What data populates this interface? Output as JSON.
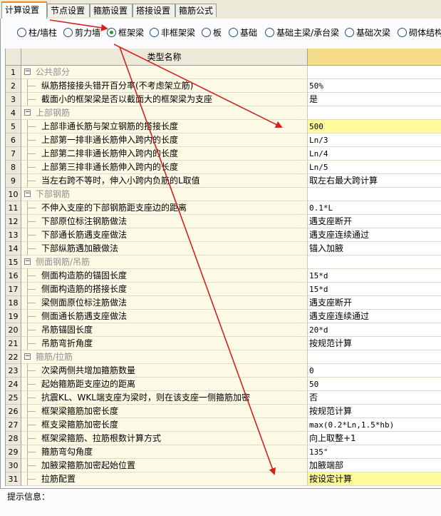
{
  "tabs": [
    "计算设置",
    "节点设置",
    "箍筋设置",
    "搭接设置",
    "箍筋公式"
  ],
  "radios": [
    "柱/墙柱",
    "剪力墙",
    "框架梁",
    "非框架梁",
    "板",
    "基础",
    "基础主梁/承台梁",
    "基础次梁",
    "砌体结构"
  ],
  "selected_radio": "框架梁",
  "grid": {
    "header": "类型名称",
    "rows": [
      {
        "n": "1",
        "name": "公共部分",
        "value": "",
        "group": true
      },
      {
        "n": "2",
        "name": "纵筋搭接接头错开百分率(不考虑架立筋)",
        "value": "50%"
      },
      {
        "n": "3",
        "name": "截面小的框架梁是否以截面大的框架梁为支座",
        "value": "是"
      },
      {
        "n": "4",
        "name": "上部钢筋",
        "value": "",
        "group": true
      },
      {
        "n": "5",
        "name": "上部非通长筋与架立钢筋的搭接长度",
        "value": "500",
        "highlight": true
      },
      {
        "n": "6",
        "name": "上部第一排非通长筋伸入跨内的长度",
        "value": "Ln/3"
      },
      {
        "n": "7",
        "name": "上部第二排非通长筋伸入跨内的长度",
        "value": "Ln/4"
      },
      {
        "n": "8",
        "name": "上部第三排非通长筋伸入跨内的长度",
        "value": "Ln/5"
      },
      {
        "n": "9",
        "name": "当左右跨不等时，伸入小跨内负筋的L取值",
        "value": "取左右最大跨计算"
      },
      {
        "n": "10",
        "name": "下部钢筋",
        "value": "",
        "group": true
      },
      {
        "n": "11",
        "name": "不伸入支座的下部钢筋距支座边的距离",
        "value": "0.1*L"
      },
      {
        "n": "12",
        "name": "下部原位标注钢筋做法",
        "value": "遇支座断开"
      },
      {
        "n": "13",
        "name": "下部通长筋遇支座做法",
        "value": "遇支座连续通过"
      },
      {
        "n": "14",
        "name": "下部纵筋遇加腋做法",
        "value": "锚入加腋"
      },
      {
        "n": "15",
        "name": "侧面钢筋/吊筋",
        "value": "",
        "group": true
      },
      {
        "n": "16",
        "name": "侧面构造筋的锚固长度",
        "value": "15*d"
      },
      {
        "n": "17",
        "name": "侧面构造筋的搭接长度",
        "value": "15*d"
      },
      {
        "n": "18",
        "name": "梁侧面原位标注筋做法",
        "value": "遇支座断开"
      },
      {
        "n": "19",
        "name": "侧面通长筋遇支座做法",
        "value": "遇支座连续通过"
      },
      {
        "n": "20",
        "name": "吊筋锚固长度",
        "value": "20*d"
      },
      {
        "n": "21",
        "name": "吊筋弯折角度",
        "value": "按规范计算"
      },
      {
        "n": "22",
        "name": "箍筋/拉筋",
        "value": "",
        "group": true
      },
      {
        "n": "23",
        "name": "次梁两侧共增加箍筋数量",
        "value": "0"
      },
      {
        "n": "24",
        "name": "起始箍筋距支座边的距离",
        "value": "50"
      },
      {
        "n": "25",
        "name": "抗震KL、WKL端支座为梁时，则在该支座一侧箍筋加密",
        "value": "否"
      },
      {
        "n": "26",
        "name": "框架梁箍筋加密长度",
        "value": "按规范计算"
      },
      {
        "n": "27",
        "name": "框支梁箍筋加密长度",
        "value": "max(0.2*Ln,1.5*hb)"
      },
      {
        "n": "28",
        "name": "框架梁箍筋、拉筋根数计算方式",
        "value": "向上取整+1"
      },
      {
        "n": "29",
        "name": "箍筋弯勾角度",
        "value": "135°"
      },
      {
        "n": "30",
        "name": "加腋梁箍筋加密起始位置",
        "value": "加腋端部"
      },
      {
        "n": "31",
        "name": "拉筋配置",
        "value": "按设定计算",
        "highlight": true
      }
    ]
  },
  "hint_label": "提示信息：",
  "colors": {
    "arrow": "#d62020",
    "header_value": "#f5dc8a",
    "highlight": "#fffb9a",
    "name_bg": "#fdfbe6"
  }
}
